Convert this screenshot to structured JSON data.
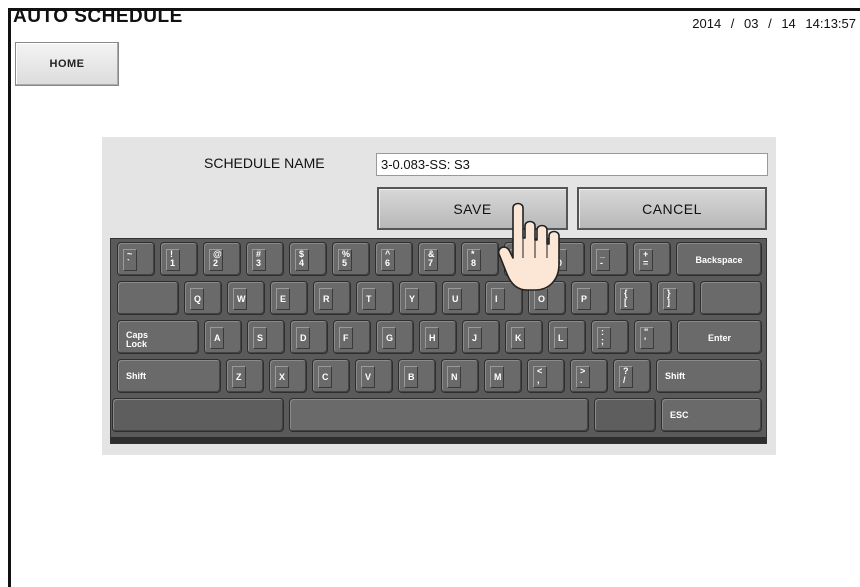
{
  "header": {
    "title": "AUTO SCHEDULE",
    "datetime": "2014 / 03 / 14  14:13:57"
  },
  "nav": {
    "home_label": "HOME"
  },
  "form": {
    "schedule_name_label": "SCHEDULE NAME",
    "schedule_name_value": "3-0.083-SS: S3",
    "save_label": "SAVE",
    "cancel_label": "CANCEL"
  },
  "keyboard": {
    "row1": [
      "~\n`",
      "!\n1",
      "@\n2",
      "#\n3",
      "$\n4",
      "%\n5",
      "^\n6",
      "&\n7",
      "*\n8",
      "(\n9",
      ")\n0",
      "_\n-",
      "+\n=",
      "Backspace"
    ],
    "row2": [
      "Q",
      "W",
      "E",
      "R",
      "T",
      "Y",
      "U",
      "I",
      "O",
      "P",
      "{\n[",
      "}\n]"
    ],
    "row3": [
      "Caps\nLock",
      "A",
      "S",
      "D",
      "F",
      "G",
      "H",
      "J",
      "K",
      "L",
      ":\n;",
      "\"\n'",
      "Enter"
    ],
    "row4": [
      "Shift",
      "Z",
      "X",
      "C",
      "V",
      "B",
      "N",
      "M",
      "<\n,",
      ">\n.",
      "?\n/",
      "Shift"
    ],
    "esc": "ESC"
  }
}
